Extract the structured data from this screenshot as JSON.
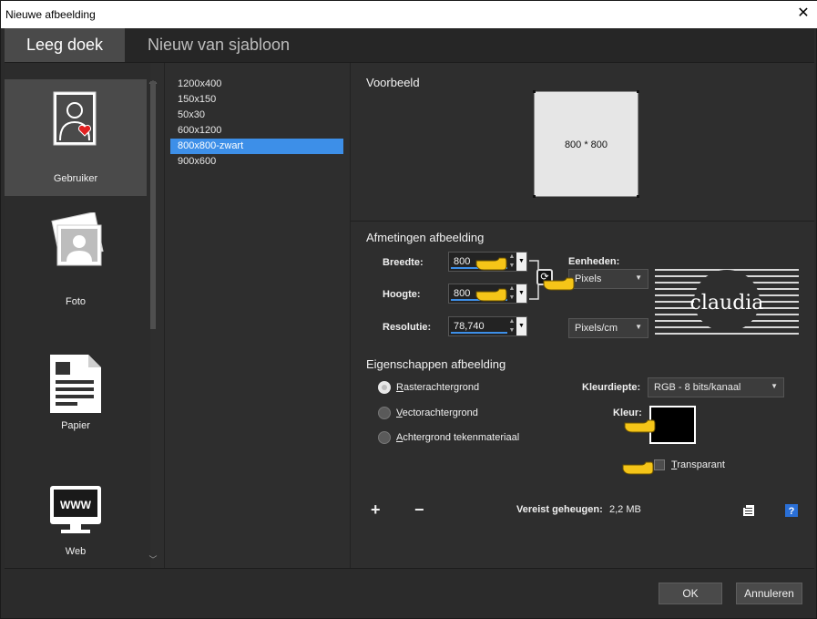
{
  "window": {
    "title": "Nieuwe afbeelding",
    "close_glyph": "✕"
  },
  "tabs": [
    {
      "label": "Leeg doek"
    },
    {
      "label": "Nieuw van sjabloon"
    }
  ],
  "categories": [
    {
      "label": "Gebruiker",
      "icon": "user-icon"
    },
    {
      "label": "Foto",
      "icon": "photo-icon"
    },
    {
      "label": "Papier",
      "icon": "paper-icon"
    },
    {
      "label": "Web",
      "icon": "web-monitor-icon"
    }
  ],
  "templates": [
    "1200x400",
    "150x150",
    "50x30",
    "600x1200",
    "800x800-zwart",
    "900x600"
  ],
  "selected_template": "800x800-zwart",
  "preview": {
    "title": "Voorbeeld",
    "text": "800 * 800"
  },
  "dimensions": {
    "title": "Afmetingen afbeelding",
    "width_label": "Breedte:",
    "width_value": "800",
    "height_label": "Hoogte:",
    "height_value": "800",
    "resolution_label": "Resolutie:",
    "resolution_value": "78,740",
    "units_label": "Eenheden:",
    "units_value": "Pixels",
    "res_units_value": "Pixels/cm"
  },
  "properties": {
    "title": "Eigenschappen afbeelding",
    "radio_options": [
      "Rasterachtergrond",
      "Vectorachtergrond",
      "Achtergrond tekenmateriaal"
    ],
    "selected_radio": 0,
    "color_depth_label": "Kleurdiepte:",
    "color_depth_value": "RGB - 8 bits/kanaal",
    "color_label": "Kleur:",
    "color_value": "#000000",
    "transparent_label": "Transparant",
    "transparent_checked": false
  },
  "memory": {
    "label": "Vereist geheugen:",
    "value": "2,2 MB"
  },
  "watermark": {
    "text": "claudia"
  },
  "buttons": {
    "ok": "OK",
    "cancel": "Annuleren"
  },
  "colors": {
    "accent": "#3d8fe8",
    "pointer": "#f5c518"
  }
}
